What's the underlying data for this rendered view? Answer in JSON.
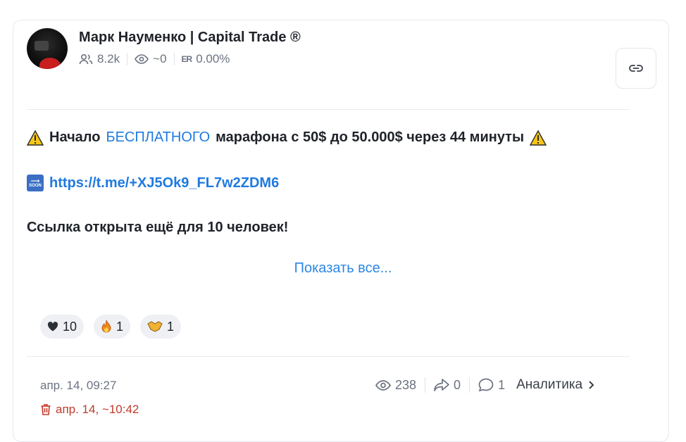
{
  "channel": {
    "name": "Марк Науменко | Capital Trade ®",
    "subscribers": "8.2k",
    "views": "~0",
    "er_label": "ER",
    "er_value": "0.00%"
  },
  "post": {
    "line1_before": "Начало",
    "line1_highlight": "БЕСПЛАТНОГО",
    "line1_after": "марафона с 50$ до 50.000$ через 44 минуты",
    "link": "https://t.me/+XJ5Ok9_FL7w2ZDM6",
    "line3": "Ссылка открыта ещё для 10 человек!",
    "soon_icon_text": "SOON",
    "show_all": "Показать все..."
  },
  "reactions": [
    {
      "icon": "heart-icon",
      "count": "10"
    },
    {
      "icon": "fire-icon",
      "count": "1"
    },
    {
      "icon": "handshake-icon",
      "count": "1"
    }
  ],
  "footer": {
    "date": "апр. 14, 09:27",
    "deleted": "апр. 14, ~10:42",
    "views": "238",
    "shares": "0",
    "comments": "1",
    "analytics": "Аналитика"
  },
  "colors": {
    "accent": "#1f7ae0",
    "deleted": "#c0392b",
    "muted": "#6b7280"
  }
}
